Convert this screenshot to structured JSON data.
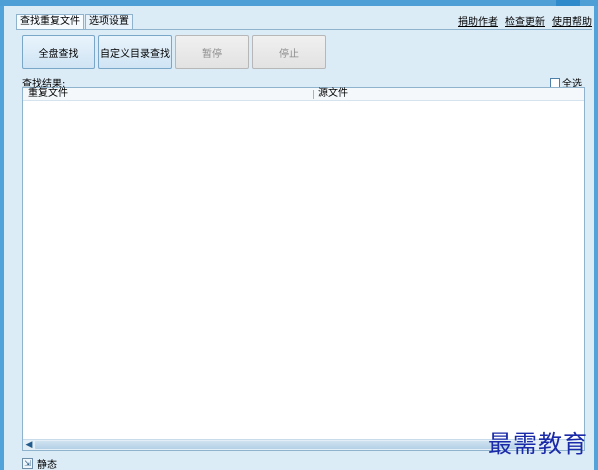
{
  "tabs": [
    {
      "label": "查找重复文件",
      "active": true
    },
    {
      "label": "选项设置",
      "active": false
    }
  ],
  "top_links": [
    "捐助作者",
    "检查更新",
    "使用帮助"
  ],
  "buttons": {
    "full_scan": "全盘查找",
    "custom_dir": "自定义目录查找",
    "pause": "暂停",
    "stop": "停止"
  },
  "results": {
    "label": "查找结果:",
    "select_all": "全选",
    "columns": [
      "重复文件",
      "源文件"
    ]
  },
  "status": {
    "text": "静态"
  },
  "watermark": "最需教育",
  "colors": {
    "frame": "#52a3d9",
    "panel": "#dcecf7",
    "watermark": "#1a2aa8"
  }
}
